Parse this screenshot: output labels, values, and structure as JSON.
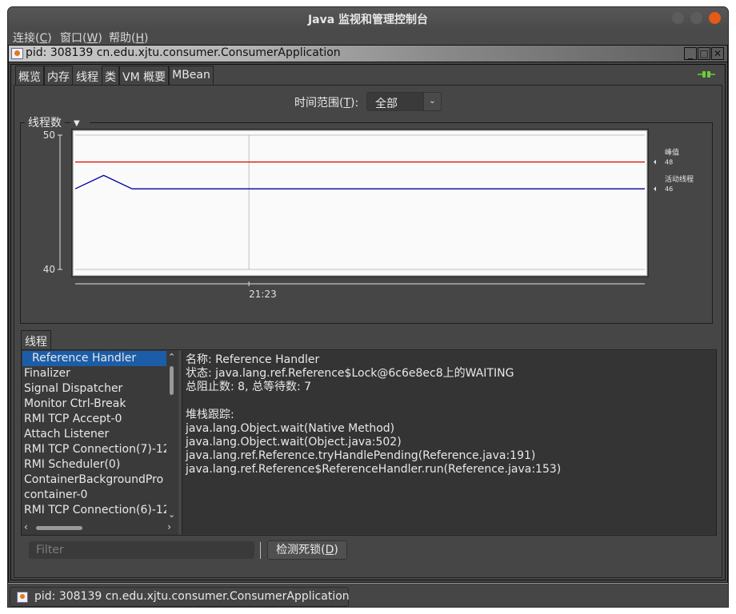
{
  "window": {
    "title": "Java 监视和管理控制台",
    "controls": [
      "minimize",
      "maximize",
      "close"
    ]
  },
  "menubar": {
    "items": [
      {
        "label": "连接(",
        "mnemonic": "C",
        "suffix": ")"
      },
      {
        "label": "窗口(",
        "mnemonic": "W",
        "suffix": ")"
      },
      {
        "label": "帮助(",
        "mnemonic": "H",
        "suffix": ")"
      }
    ]
  },
  "internal_frame": {
    "title": "pid: 308139 cn.edu.xjtu.consumer.ConsumerApplication",
    "buttons": [
      "_",
      "□",
      "✕"
    ]
  },
  "tabs": [
    {
      "label": "概览",
      "active": false
    },
    {
      "label": "内存",
      "active": false
    },
    {
      "label": "线程",
      "active": true
    },
    {
      "label": "类",
      "active": false
    },
    {
      "label": "VM 概要",
      "active": false
    },
    {
      "label": "MBean",
      "active": false
    }
  ],
  "time_range": {
    "label_pre": "时间范围(",
    "mnemonic": "T",
    "label_post": "):",
    "selected": "全部"
  },
  "chart_panel": {
    "title": "线程数"
  },
  "chart_data": {
    "type": "line",
    "title": "线程数",
    "xlabel": "",
    "ylabel": "",
    "ylim": [
      40,
      50
    ],
    "yticks": [
      40,
      50
    ],
    "xticks": [
      "21:23"
    ],
    "xtick_positions": [
      0.305
    ],
    "grid": true,
    "legend_position": "right",
    "x": [
      0,
      0.05,
      0.1,
      1.0
    ],
    "series": [
      {
        "name": "峰值",
        "color": "#e00000",
        "current": 48,
        "values": [
          48,
          48,
          48,
          48
        ]
      },
      {
        "name": "活动线程",
        "color": "#0000a0",
        "current": 46,
        "values": [
          46,
          47,
          46,
          46
        ]
      }
    ]
  },
  "threads_section": {
    "tab_label": "线程",
    "list": [
      "Reference Handler",
      "Finalizer",
      "Signal Dispatcher",
      "Monitor Ctrl-Break",
      "RMI TCP Accept-0",
      "Attach Listener",
      "RMI TCP Connection(7)-12",
      "RMI Scheduler(0)",
      "ContainerBackgroundPro",
      "container-0",
      "RMI TCP Connection(6)-12"
    ],
    "selected_index": 0,
    "detail": {
      "name_line": "名称: Reference Handler",
      "state_line": "状态: java.lang.ref.Reference$Lock@6c6e8ec8上的WAITING",
      "counts_line": "总阻止数: 8, 总等待数: 7",
      "stack_header": "堆栈跟踪:",
      "stack": [
        "java.lang.Object.wait(Native Method)",
        "java.lang.Object.wait(Object.java:502)",
        "java.lang.ref.Reference.tryHandlePending(Reference.java:191)",
        "java.lang.ref.Reference$ReferenceHandler.run(Reference.java:153)"
      ]
    },
    "filter_placeholder": "Filter",
    "deadlock_button": {
      "label_pre": "检测死锁(",
      "mnemonic": "D",
      "label_post": ")"
    }
  },
  "taskbar": {
    "item_label": "pid: 308139 cn.edu.xjtu.consumer.ConsumerApplication"
  }
}
